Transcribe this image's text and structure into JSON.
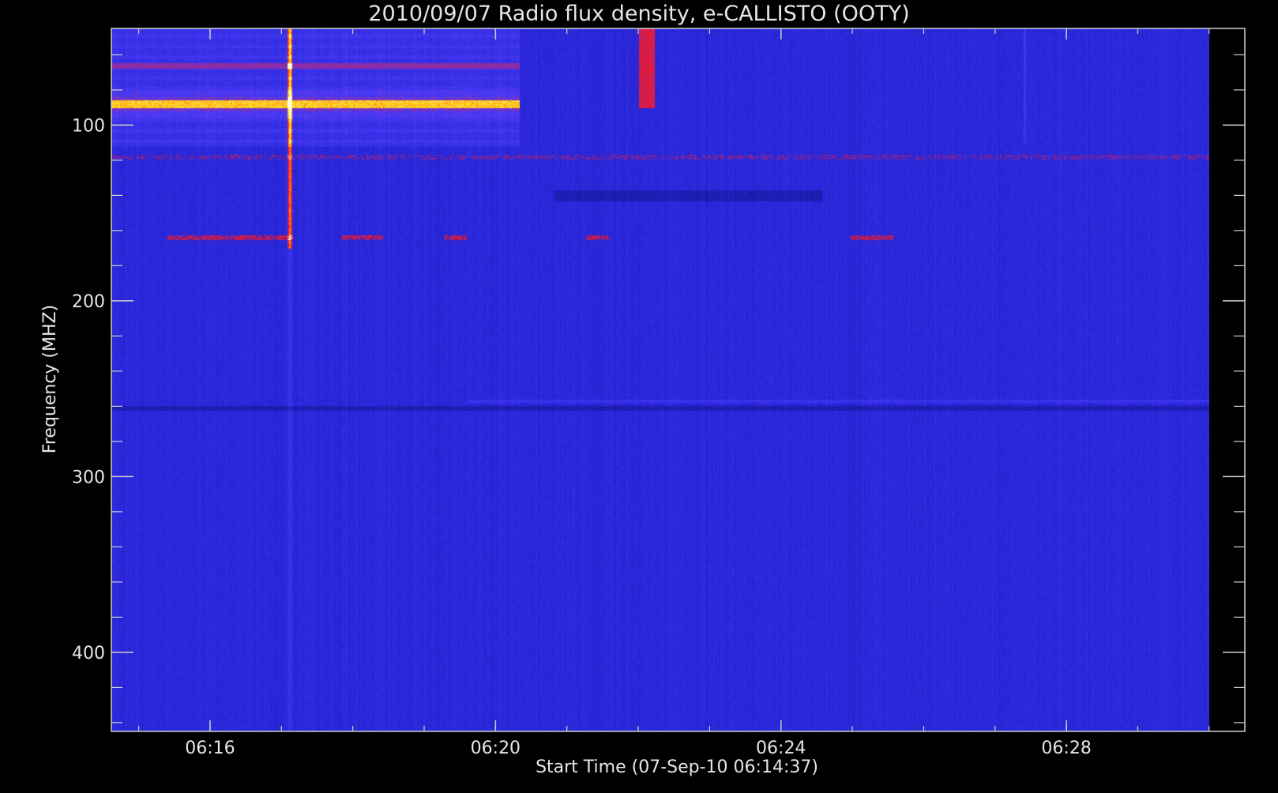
{
  "chart_data": {
    "type": "heatmap",
    "title": "2010/09/07  Radio flux density, e-CALLISTO (OOTY)",
    "xlabel": "Start Time (07-Sep-10 06:14:37)",
    "ylabel": "Frequency (MHZ)",
    "x_tick_labels": [
      "06:16",
      "06:20",
      "06:24",
      "06:28"
    ],
    "y_tick_labels": [
      "100",
      "200",
      "300",
      "400"
    ],
    "ylim": [
      45,
      445
    ],
    "xlim": [
      "06:14:37",
      "06:30:30"
    ],
    "y_inverted": true,
    "data_time_range": [
      "06:14:37",
      "06:30:00"
    ],
    "data_freq_range": [
      45,
      445
    ],
    "colormap": "blue-red-yellow",
    "background_level_color": "#2323c8",
    "features": {
      "burst_time": "06:17:07",
      "burst_time_2": "06:22:07",
      "spike_time": "06:27:25",
      "bright_band_freq_mhz": 88,
      "band_cutoff_time": "06:20:20"
    }
  },
  "colors": {
    "background": "#000000",
    "frame": "#d0d0d0",
    "text": "#e6e6e6"
  }
}
